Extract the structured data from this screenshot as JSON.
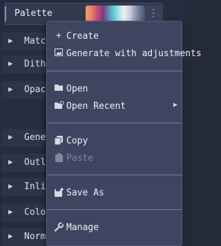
{
  "header": {
    "title": "Palette",
    "menu_icon": "⋮"
  },
  "rows": [
    {
      "label": "Match"
    },
    {
      "label": "Dither"
    },
    {
      "label": "Opaci"
    },
    {
      "label": "Gener"
    },
    {
      "label": "Outlin"
    },
    {
      "label": "Inline"
    },
    {
      "label": "Color"
    },
    {
      "label": "Norma"
    }
  ],
  "menu": {
    "items": {
      "create": "Create",
      "generate": "Generate with adjustments",
      "open": "Open",
      "open_recent": "Open Recent",
      "copy": "Copy",
      "paste": "Paste",
      "save_as": "Save As",
      "manage": "Manage"
    }
  }
}
